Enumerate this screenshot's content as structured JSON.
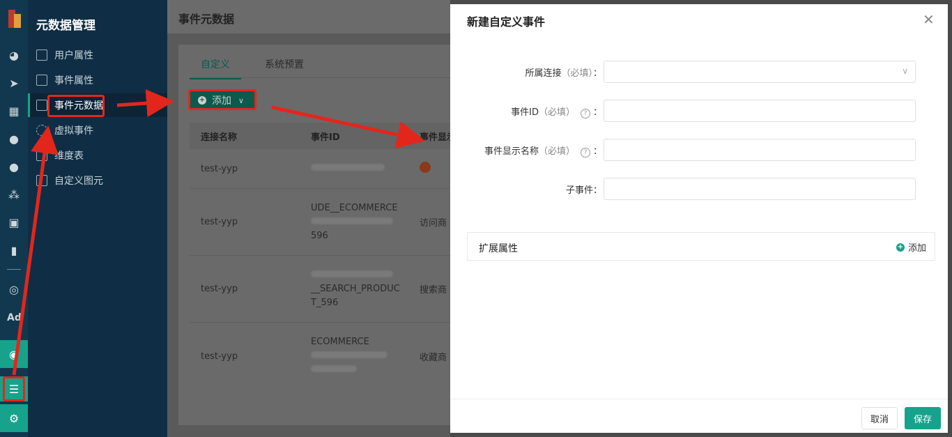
{
  "sidebar": {
    "title": "元数据管理",
    "items": [
      {
        "label": "用户属性",
        "icon": "document-icon"
      },
      {
        "label": "事件属性",
        "icon": "clipboard-icon"
      },
      {
        "label": "事件元数据",
        "icon": "table-icon",
        "active": true
      },
      {
        "label": "虚拟事件",
        "icon": "virtual-icon"
      },
      {
        "label": "维度表",
        "icon": "dimension-icon"
      },
      {
        "label": "自定义图元",
        "icon": "shapes-icon"
      }
    ]
  },
  "rail": {
    "icons": [
      "dashboard-icon",
      "send-icon",
      "layout-icon",
      "user-icon",
      "users-icon",
      "cluster-icon",
      "bookmark-icon",
      "bar-chart-icon",
      "wechat-icon",
      "ad-text",
      "target-icon",
      "database-icon",
      "gear-icon"
    ],
    "ad_text": "Ad"
  },
  "main": {
    "title": "事件元数据",
    "tabs": [
      {
        "label": "自定义",
        "active": true
      },
      {
        "label": "系统预置"
      }
    ],
    "add_label": "添加",
    "table": {
      "headers": [
        "连接名称",
        "事件ID",
        "事件显示"
      ],
      "rows": [
        {
          "conn": "test-yyp",
          "id_lines": [],
          "display": ""
        },
        {
          "conn": "test-yyp",
          "id_lines": [
            "UDE__ECOMMERCE",
            "",
            "596"
          ],
          "display": "访问商"
        },
        {
          "conn": "test-yyp",
          "id_lines": [
            "",
            "__SEARCH_PRODUC",
            "T_596"
          ],
          "display": "搜索商"
        },
        {
          "conn": "test-yyp",
          "id_lines": [
            "ECOMMERCE",
            "",
            ""
          ],
          "display": "收藏商"
        }
      ]
    }
  },
  "drawer": {
    "title": "新建自定义事件",
    "fields": [
      {
        "label": "所属连接",
        "req": "（必填）",
        "suffix": "：",
        "type": "select",
        "value": ""
      },
      {
        "label": "事件ID",
        "req": "（必填）",
        "suffix": "：",
        "help": true,
        "type": "text",
        "value": ""
      },
      {
        "label": "事件显示名称",
        "req": "（必填）",
        "suffix": "：",
        "help": true,
        "type": "text",
        "value": ""
      },
      {
        "label": "子事件",
        "req": "",
        "suffix": "：",
        "type": "text",
        "value": ""
      }
    ],
    "ext_label": "扩展属性",
    "ext_add": "添加",
    "cancel": "取消",
    "save": "保存"
  },
  "colors": {
    "accent": "#17a28c",
    "annotation": "#e3261c",
    "sidebar_bg": "#0f2e45"
  }
}
